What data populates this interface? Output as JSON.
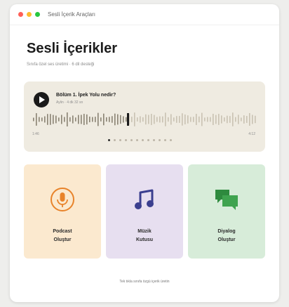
{
  "window": {
    "title": "Sesli İçerik Araçları",
    "controls": [
      {
        "name": "close",
        "color": "#ff5f57"
      },
      {
        "name": "minimize",
        "color": "#febc2e"
      },
      {
        "name": "maximize",
        "color": "#28c840"
      }
    ]
  },
  "header": {
    "title": "Sesli İçerikler",
    "subtitle": "Sınıfa özel ses üretimi · 6 dil desteği"
  },
  "player": {
    "episode_title": "Bölüm 1. İpek Yolu nedir?",
    "episode_meta": "Aylin · 4 dk 32 sn",
    "time_elapsed": "1:46",
    "time_total": "4:12",
    "progress": 0.42,
    "pages_total": 12,
    "current_page": 1,
    "play_icon": "play-icon"
  },
  "cards": [
    {
      "line1": "Podcast",
      "line2": "Oluştur",
      "icon": "microphone-icon",
      "accent": "#e8832a"
    },
    {
      "line1": "Müzik",
      "line2": "Kutusu",
      "icon": "music-note-icon",
      "accent": "#3b3f8f"
    },
    {
      "line1": "Diyalog",
      "line2": "Oluştur",
      "icon": "chat-bubbles-icon",
      "accent": "#2e8a3e"
    }
  ],
  "footer": {
    "note": "Tek tıkla sınıfa özgü içerik üretin"
  }
}
